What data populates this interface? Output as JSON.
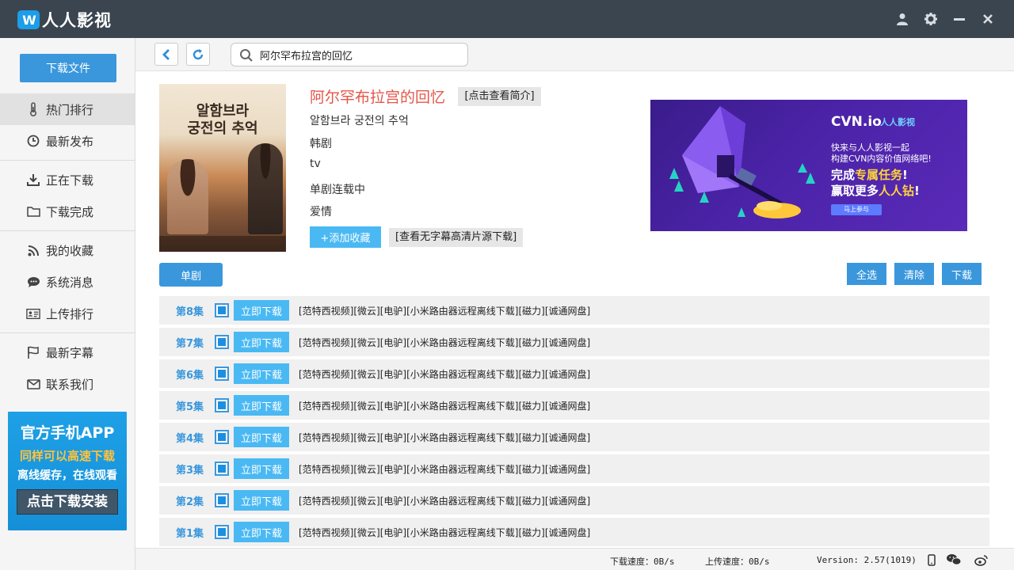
{
  "app": {
    "logo_mark": "W",
    "name": "人人影视"
  },
  "window_controls": [
    "user-icon",
    "gear-icon",
    "minimize-icon",
    "close-icon"
  ],
  "sidebar": {
    "download_file_label": "下载文件",
    "items": [
      {
        "label": "热门排行",
        "icon": "thermometer-icon",
        "active": true
      },
      {
        "label": "最新发布",
        "icon": "clock-icon"
      },
      {
        "label": "正在下载",
        "icon": "download-icon"
      },
      {
        "label": "下载完成",
        "icon": "folder-icon"
      },
      {
        "label": "我的收藏",
        "icon": "rss-icon"
      },
      {
        "label": "系统消息",
        "icon": "chat-icon"
      },
      {
        "label": "上传排行",
        "icon": "id-card-icon"
      },
      {
        "label": "最新字幕",
        "icon": "flag-icon"
      },
      {
        "label": "联系我们",
        "icon": "mail-icon"
      }
    ],
    "promo": {
      "title": "官方手机APP",
      "sub1": "同样可以高速下载",
      "sub2": "离线缓存，在线观看",
      "button": "点击下载安装"
    }
  },
  "toolbar": {
    "search_value": "阿尔罕布拉宫的回忆"
  },
  "show": {
    "title": "阿尔罕布拉宫的回忆",
    "intro_button": "[点击查看简介]",
    "korean_title": "알함브라 궁전의 추억",
    "region": "韩剧",
    "channel": "tv",
    "status": "单剧连载中",
    "genre": "爱情",
    "favorite_button": "+添加收藏",
    "hd_button": "[查看无字幕高清片源下载]",
    "poster_text": "알함브라\n궁전의 추억"
  },
  "ad": {
    "brand": "CVN.io",
    "brand2": "人人影视",
    "line1": "快来与人人影视一起",
    "line2": "构建CVN内容价值网络吧!",
    "line3a": "完成",
    "line3b": "专属任务",
    "line3c": "!",
    "line4a": "赢取更多",
    "line4b": "人人钻",
    "line4c": "!",
    "button": "马上参与"
  },
  "category_tab": "单剧",
  "actions": {
    "select_all": "全选",
    "clear": "清除",
    "download": "下载"
  },
  "episodes": [
    {
      "label": "第8集"
    },
    {
      "label": "第7集"
    },
    {
      "label": "第6集"
    },
    {
      "label": "第5集"
    },
    {
      "label": "第4集"
    },
    {
      "label": "第3集"
    },
    {
      "label": "第2集"
    },
    {
      "label": "第1集"
    }
  ],
  "episode_download_label": "立即下载",
  "sources": [
    "[范特西视频]",
    "[微云]",
    "[电驴]",
    "[小米路由器远程离线下载]",
    "[磁力]",
    "[诚通网盘]"
  ],
  "statusbar": {
    "download_speed": "下载速度：0B/s",
    "upload_speed": "上传速度：0B/s",
    "version": "Version: 2.57(1019)"
  },
  "colors": {
    "titlebar": "#3b4550",
    "accent": "#3a97dc",
    "light_accent": "#4ab9f3",
    "title_red": "#e4564a"
  }
}
